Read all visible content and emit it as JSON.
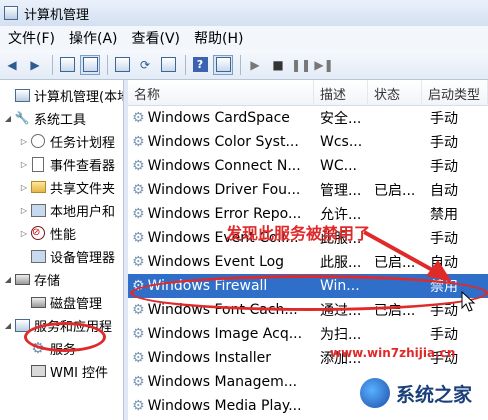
{
  "window": {
    "title": "计算机管理"
  },
  "menu": [
    "文件(F)",
    "操作(A)",
    "查看(V)",
    "帮助(H)"
  ],
  "toolbar": {
    "help_label": "?"
  },
  "tree": {
    "items": [
      {
        "label": "计算机管理(本地",
        "arrow": "",
        "icon": "management-icon"
      },
      {
        "label": "系统工具",
        "arrow": "◢",
        "icon": "tools-icon"
      },
      {
        "label": "任务计划程",
        "arrow": "▷",
        "icon": "clock-icon"
      },
      {
        "label": "事件查看器",
        "arrow": "▷",
        "icon": "event-viewer-icon"
      },
      {
        "label": "共享文件夹",
        "arrow": "▷",
        "icon": "shared-folder-icon"
      },
      {
        "label": "本地用户和",
        "arrow": "▷",
        "icon": "local-users-icon"
      },
      {
        "label": "性能",
        "arrow": "▷",
        "icon": "performance-icon"
      },
      {
        "label": "设备管理器",
        "arrow": "",
        "icon": "device-manager-icon"
      },
      {
        "label": "存储",
        "arrow": "◢",
        "icon": "storage-icon"
      },
      {
        "label": "磁盘管理",
        "arrow": "",
        "icon": "disk-icon"
      },
      {
        "label": "服务和应用程",
        "arrow": "◢",
        "icon": "services-apps-icon"
      },
      {
        "label": "服务",
        "arrow": "",
        "icon": "services-gear-icon"
      },
      {
        "label": "WMI 控件",
        "arrow": "",
        "icon": "wmi-icon"
      }
    ]
  },
  "list": {
    "columns": [
      "名称",
      "描述",
      "状态",
      "启动类型"
    ],
    "rows": [
      {
        "name": "Windows CardSpace",
        "desc": "安全...",
        "status": "",
        "startup": "手动"
      },
      {
        "name": "Windows Color Syst...",
        "desc": "Wcs...",
        "status": "",
        "startup": "手动"
      },
      {
        "name": "Windows Connect N...",
        "desc": "WC...",
        "status": "",
        "startup": "手动"
      },
      {
        "name": "Windows Driver Fou...",
        "desc": "管理...",
        "status": "已启...",
        "startup": "自动"
      },
      {
        "name": "Windows Error Repo...",
        "desc": "允许...",
        "status": "",
        "startup": "禁用"
      },
      {
        "name": "Windows Event Coll...",
        "desc": "此服...",
        "status": "",
        "startup": "手动"
      },
      {
        "name": "Windows Event Log",
        "desc": "此服...",
        "status": "已启...",
        "startup": "自动"
      },
      {
        "name": "Windows Firewall",
        "desc": "Win...",
        "status": "",
        "startup": "禁用"
      },
      {
        "name": "Windows Font Cach...",
        "desc": "通过...",
        "status": "已启...",
        "startup": "手动"
      },
      {
        "name": "Windows Image Acq...",
        "desc": "为扫...",
        "status": "",
        "startup": "手动"
      },
      {
        "name": "Windows Installer",
        "desc": "添加...",
        "status": "",
        "startup": "手动"
      },
      {
        "name": "Windows Managem...",
        "desc": "",
        "status": "",
        "startup": ""
      },
      {
        "name": "Windows Media Play...",
        "desc": "",
        "status": "",
        "startup": ""
      }
    ]
  },
  "annotation": {
    "text": "发现此服务被禁用了",
    "color": "#e02a2a"
  },
  "watermark": {
    "url": "www.win7zhijia.cn",
    "logo_text": "系统之家"
  },
  "colors": {
    "selection": "#2f6fc9",
    "highlight": "#e02a2a"
  }
}
